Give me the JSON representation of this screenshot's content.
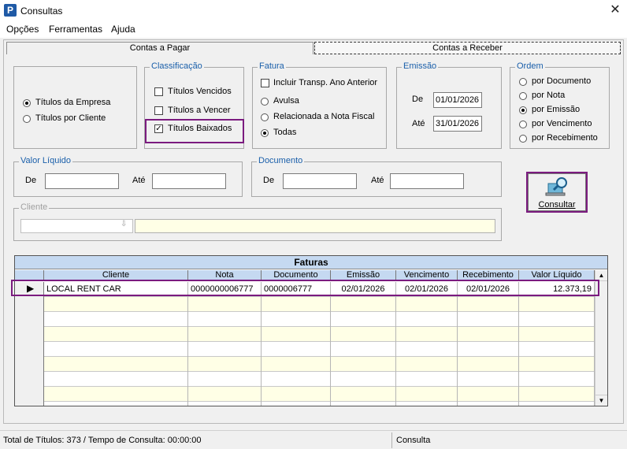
{
  "window": {
    "title": "Consultas",
    "icon_letter": "P",
    "close": "✕"
  },
  "menu": [
    "Opções",
    "Ferramentas",
    "Ajuda"
  ],
  "tabs": [
    {
      "label": "Contas a Pagar",
      "active": true
    },
    {
      "label": "Contas a Receber",
      "active": false
    }
  ],
  "titulos": {
    "options": [
      "Títulos da Empresa",
      "Títulos por Cliente"
    ],
    "selected": 0
  },
  "classificacao": {
    "legend": "Classificação",
    "items": [
      {
        "label": "Títulos Vencidos",
        "checked": false
      },
      {
        "label": "Títulos a Vencer",
        "checked": false
      },
      {
        "label": "Títulos Baixados",
        "checked": true
      }
    ]
  },
  "fatura": {
    "legend": "Fatura",
    "checkbox_label": "Incluir Transp. Ano Anterior",
    "options": [
      "Avulsa",
      "Relacionada a Nota Fiscal",
      "Todas"
    ],
    "selected": 2
  },
  "emissao": {
    "legend": "Emissão",
    "de_label": "De",
    "de_value": "01/01/2026",
    "ate_label": "Até",
    "ate_value": "31/01/2026"
  },
  "ordem": {
    "legend": "Ordem",
    "options": [
      "por Documento",
      "por Nota",
      "por Emissão",
      "por Vencimento",
      "por Recebimento"
    ],
    "selected": 2
  },
  "valor_liquido": {
    "legend": "Valor Líquido",
    "de_label": "De",
    "ate_label": "Até",
    "de_value": "",
    "ate_value": ""
  },
  "documento": {
    "legend": "Documento",
    "de_label": "De",
    "ate_label": "Até",
    "de_value": "",
    "ate_value": ""
  },
  "cliente": {
    "legend": "Cliente",
    "value": "",
    "name": ""
  },
  "consultar_button": {
    "label": "Consultar"
  },
  "grid": {
    "title": "Faturas",
    "columns": [
      "Cliente",
      "Nota",
      "Documento",
      "Emissão",
      "Vencimento",
      "Recebimento",
      "Valor Líquido"
    ],
    "rows": [
      {
        "cliente": "LOCAL      RENT     CAR",
        "nota": "0000000006777",
        "documento": "0000006777",
        "emissao": "02/01/2026",
        "vencimento": "02/01/2026",
        "recebimento": "02/01/2026",
        "valor": "12.373,19"
      }
    ]
  },
  "status": {
    "left": "Total de Títulos: 373 / Tempo de Consulta: 00:00:00",
    "right": "Consulta"
  },
  "colors": {
    "legend": "#1a5faa",
    "highlight": "#7b1b7f",
    "grid_header": "#c5d9f1",
    "input_yellow": "#ffffe6"
  }
}
